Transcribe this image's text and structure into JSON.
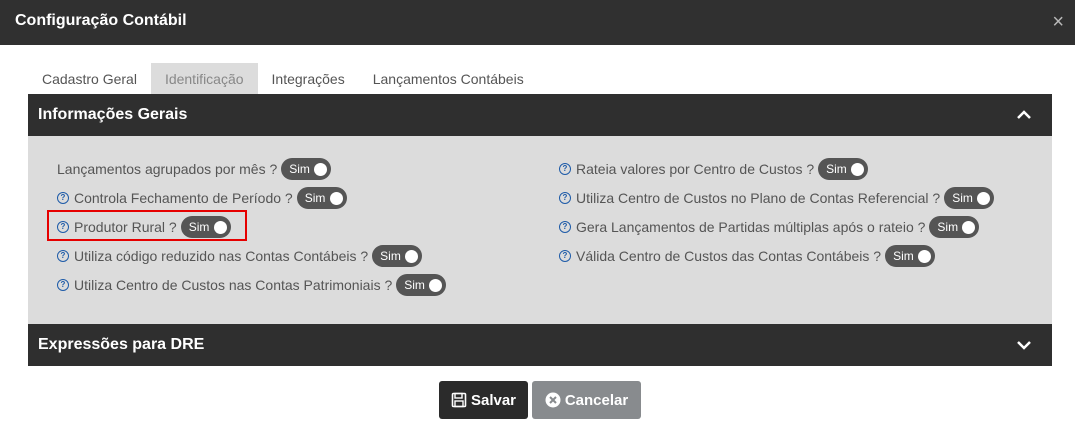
{
  "dialog": {
    "title": "Configuração Contábil",
    "close_glyph": "×"
  },
  "tabs": [
    {
      "label": "Cadastro Geral",
      "active": false
    },
    {
      "label": "Identificação",
      "active": true
    },
    {
      "label": "Integrações",
      "active": false
    },
    {
      "label": "Lançamentos Contábeis",
      "active": false
    }
  ],
  "sections": {
    "info_gerais": {
      "title": "Informações Gerais",
      "expanded": true
    },
    "dre": {
      "title": "Expressões para DRE",
      "expanded": false
    }
  },
  "options": {
    "left": [
      {
        "label": "Lançamentos agrupados por mês ?",
        "help": false,
        "value": "Sim"
      },
      {
        "label": "Controla Fechamento de Período ?",
        "help": true,
        "value": "Sim"
      },
      {
        "label": "Produtor Rural ?",
        "help": true,
        "value": "Sim",
        "highlighted": true
      },
      {
        "label": "Utiliza código reduzido nas Contas Contábeis ?",
        "help": true,
        "value": "Sim"
      },
      {
        "label": "Utiliza Centro de Custos nas Contas Patrimoniais ?",
        "help": true,
        "value": "Sim"
      }
    ],
    "right": [
      {
        "label": "Rateia valores por Centro de Custos ?",
        "help": true,
        "value": "Sim"
      },
      {
        "label": "Utiliza Centro de Custos no Plano de Contas Referencial ?",
        "help": true,
        "value": "Sim"
      },
      {
        "label": "Gera Lançamentos de Partidas múltiplas após o rateio ?",
        "help": true,
        "value": "Sim"
      },
      {
        "label": "Válida Centro de Custos das Contas Contábeis ?",
        "help": true,
        "value": "Sim"
      }
    ]
  },
  "help_glyph": "?",
  "buttons": {
    "save": "Salvar",
    "cancel": "Cancelar"
  },
  "colors": {
    "header": "#303030",
    "panel": "#dcdcdc",
    "toggle": "#555555",
    "highlight": "#e60000",
    "help": "#1e5ba8",
    "cancel": "#888b8e"
  }
}
